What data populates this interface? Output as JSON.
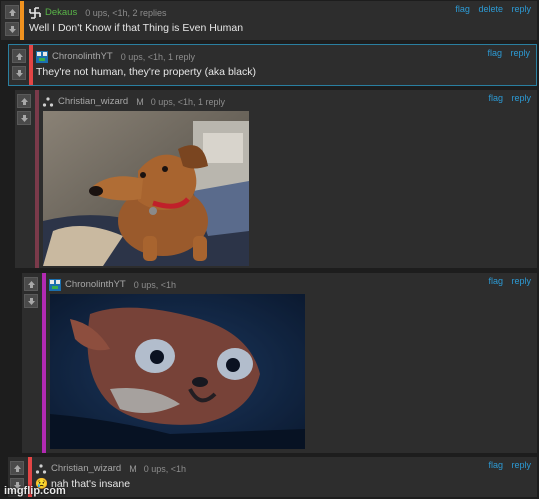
{
  "comments": [
    {
      "username": "Dekaus",
      "meta": "0 ups, <1h, 2 replies",
      "links": [
        "flag",
        "delete",
        "reply"
      ],
      "text": "Well I Don't Know if that Thing is Even Human",
      "avatar_icon": "swastika-icon",
      "bar_color": "#f0921f",
      "username_color": "#59b548"
    },
    {
      "username": "ChronolinthYT",
      "meta": "0 ups, <1h, 1 reply",
      "links": [
        "flag",
        "reply"
      ],
      "text": "They're not human, they're property (aka black)",
      "avatar_icon": "pixel-avatar-icon",
      "bar_color": "#e34545",
      "username_color": "#a8a8a8"
    },
    {
      "username": "Christian_wizard",
      "mod": "M",
      "meta": "0 ups, <1h, 1 reply",
      "links": [
        "flag",
        "reply"
      ],
      "image": "dachshund-side-eye-photo",
      "avatar_icon": "triangle-dots-icon",
      "bar_color": "#7a3a4a",
      "username_color": "#a8a8a8"
    },
    {
      "username": "ChronolinthYT",
      "meta": "0 ups, <1h",
      "links": [
        "flag",
        "reply"
      ],
      "image": "startled-fox-photo",
      "avatar_icon": "pixel-avatar-icon",
      "bar_color": "#b22ab2",
      "username_color": "#a8a8a8"
    },
    {
      "username": "Christian_wizard",
      "mod": "M",
      "meta": "0 ups, <1h",
      "links": [
        "flag",
        "reply"
      ],
      "emoji": "😢",
      "text": "nah that's insane",
      "avatar_icon": "triangle-dots-icon",
      "bar_color": "#e34545",
      "username_color": "#a8a8a8"
    }
  ],
  "watermark": "imgflip.com"
}
